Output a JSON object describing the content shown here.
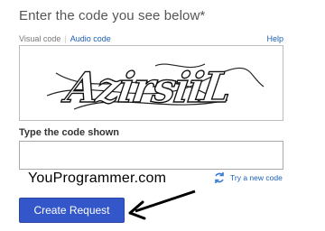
{
  "heading": "Enter the code you see below*",
  "tabs": {
    "visual": "Visual code",
    "separator": "|",
    "audio": "Audio code",
    "help": "Help"
  },
  "captcha": {
    "text": "AzirsiiL",
    "icon": "captcha-image"
  },
  "field": {
    "label": "Type the code shown",
    "value": ""
  },
  "watermark": "YouProgrammer.com",
  "try_new": {
    "label": "Try a new code",
    "icon": "refresh-icon"
  },
  "submit": {
    "label": "Create Request"
  },
  "colors": {
    "link": "#1a5fb4",
    "button": "#3356c9"
  }
}
